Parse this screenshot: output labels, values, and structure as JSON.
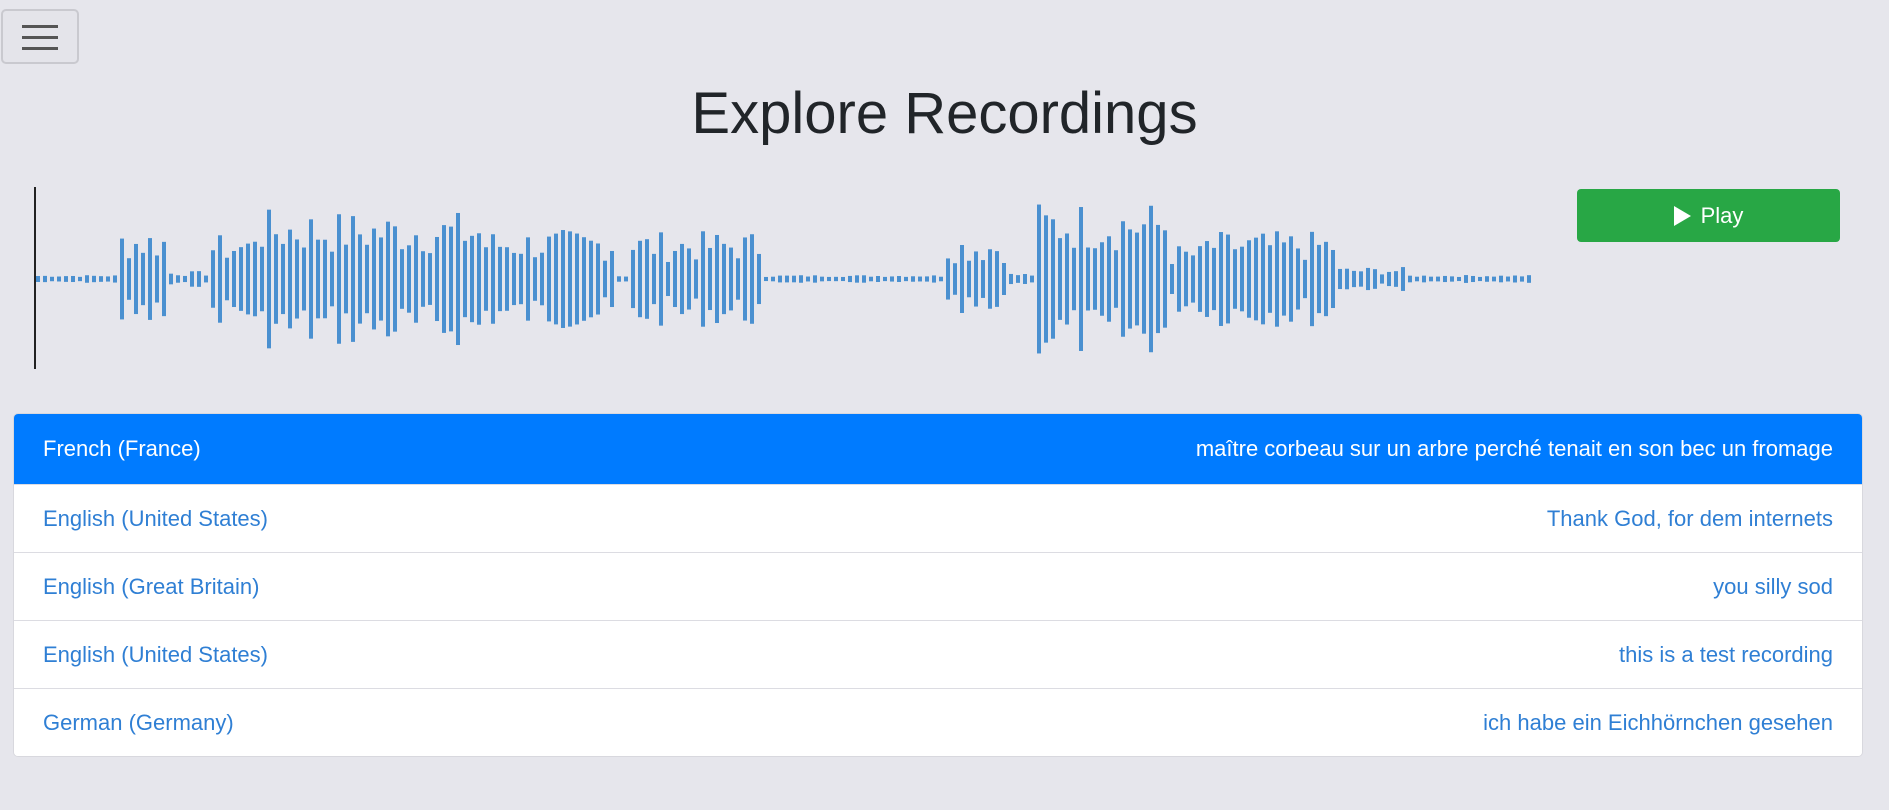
{
  "header": {
    "title": "Explore Recordings",
    "menu_icon": "hamburger-menu-icon"
  },
  "player": {
    "play_label": "Play",
    "play_icon": "play-icon",
    "waveform_color": "#4a90d0",
    "progress": 0
  },
  "recordings": [
    {
      "language": "French (France)",
      "text": "maître corbeau sur un arbre perché tenait en son bec un fromage",
      "active": true
    },
    {
      "language": "English (United States)",
      "text": "Thank God, for dem internets",
      "active": false
    },
    {
      "language": "English (Great Britain)",
      "text": "you silly sod",
      "active": false
    },
    {
      "language": "English (United States)",
      "text": "this is a test recording",
      "active": false
    },
    {
      "language": "German (Germany)",
      "text": "ich habe ein Eichhörnchen gesehen",
      "active": false
    }
  ],
  "colors": {
    "background": "#e6e6ec",
    "active_row": "#007bff",
    "link": "#2f7fd4",
    "play_button": "#28a745"
  }
}
